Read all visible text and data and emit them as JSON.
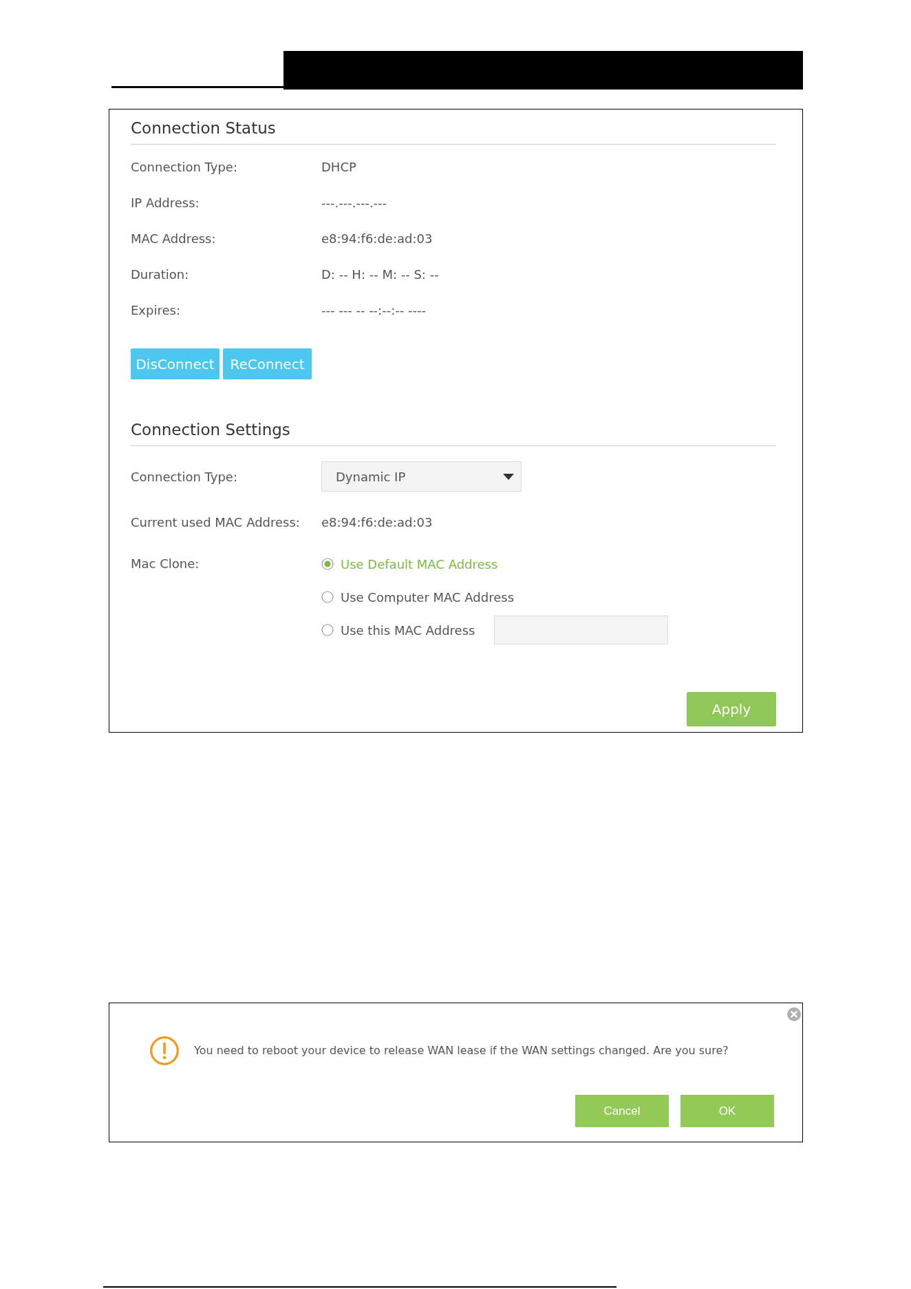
{
  "connection_status": {
    "title": "Connection Status",
    "rows": [
      {
        "label": "Connection Type:",
        "value": "DHCP"
      },
      {
        "label": "IP Address:",
        "value": "---.---.---.---"
      },
      {
        "label": "MAC Address:",
        "value": "e8:94:f6:de:ad:03"
      },
      {
        "label": "Duration:",
        "value": "D: -- H: -- M: -- S: --"
      },
      {
        "label": "Expires:",
        "value": "--- --- -- --:--:-- ----"
      }
    ],
    "buttons": [
      "DisConnect",
      "ReConnect"
    ]
  },
  "connection_settings": {
    "title": "Connection Settings",
    "connection_type": {
      "label": "Connection Type:",
      "value": "Dynamic IP"
    },
    "current_mac": {
      "label": "Current used MAC Address:",
      "value": "e8:94:f6:de:ad:03"
    },
    "mac_clone": {
      "label": "Mac Clone:",
      "options": [
        {
          "label": "Use Default MAC Address",
          "selected": true,
          "kind": "radio"
        },
        {
          "label": "Use Computer MAC Address",
          "selected": false,
          "kind": "radio"
        },
        {
          "label": "Use this MAC Address",
          "selected": false,
          "kind": "radio_with_field"
        }
      ]
    },
    "apply_button": "Apply"
  },
  "dialog": {
    "message": "You need to reboot your device to release WAN lease if the WAN settings changed. Are you sure?",
    "buttons": [
      "Cancel",
      "OK"
    ]
  }
}
